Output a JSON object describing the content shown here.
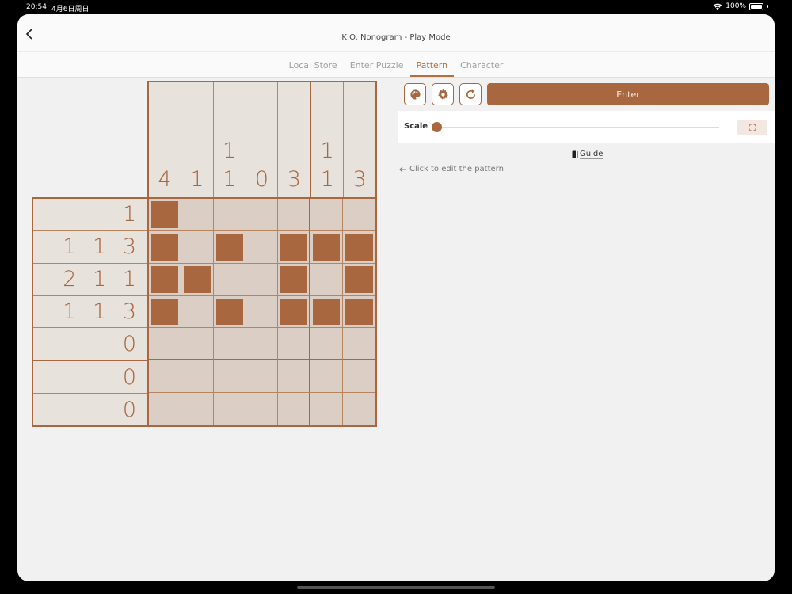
{
  "status_bar": {
    "time": "20:54",
    "date": "4月6日周日",
    "battery": "100%"
  },
  "nav": {
    "title": "K.O. Nonogram - Play Mode"
  },
  "tabs": [
    {
      "label": "Local Store",
      "active": false
    },
    {
      "label": "Enter Puzzle",
      "active": false
    },
    {
      "label": "Pattern",
      "active": true
    },
    {
      "label": "Character",
      "active": false
    }
  ],
  "toolbar": {
    "enter_label": "Enter",
    "buttons": [
      "palette-icon",
      "gear-icon",
      "refresh-icon"
    ]
  },
  "scale": {
    "label": "Scale",
    "value": 0
  },
  "guide": {
    "label": "Guide"
  },
  "edit_hint": {
    "label": "Click to edit the pattern"
  },
  "puzzle": {
    "column_clues": [
      [
        "4"
      ],
      [
        "1"
      ],
      [
        "1",
        "1"
      ],
      [
        "0"
      ],
      [
        "3"
      ],
      [
        "1",
        "1"
      ],
      [
        "3"
      ]
    ],
    "row_clues": [
      "1",
      "1 1 3",
      "2 1 1",
      "1 1 3",
      "0",
      "0",
      "0"
    ],
    "grid": [
      [
        1,
        0,
        0,
        0,
        0,
        0,
        0
      ],
      [
        1,
        0,
        1,
        0,
        1,
        1,
        1
      ],
      [
        1,
        1,
        0,
        0,
        1,
        0,
        1
      ],
      [
        1,
        0,
        1,
        0,
        1,
        1,
        1
      ],
      [
        0,
        0,
        0,
        0,
        0,
        0,
        0
      ],
      [
        0,
        0,
        0,
        0,
        0,
        0,
        0
      ],
      [
        0,
        0,
        0,
        0,
        0,
        0,
        0
      ]
    ]
  },
  "colors": {
    "accent": "#a8673f",
    "cell_bg": "#dbcfc5",
    "clue_bg": "#e8e2dc"
  }
}
